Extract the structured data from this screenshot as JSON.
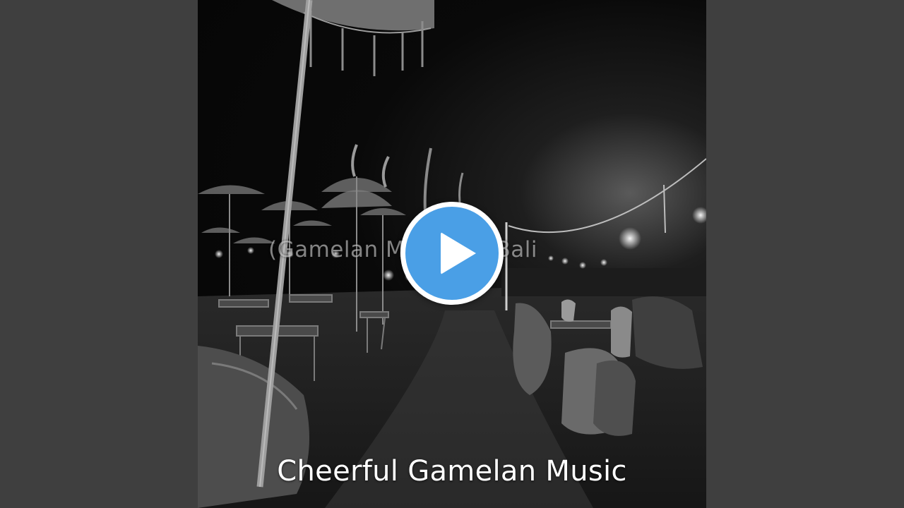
{
  "video": {
    "overlay_title": "(Gamelan Music for Bali",
    "cover_text": "Cheerful Gamelan Music",
    "play_icon": "play-icon",
    "play_color": "#4a9fe6",
    "background_color": "#3f3f3f"
  }
}
